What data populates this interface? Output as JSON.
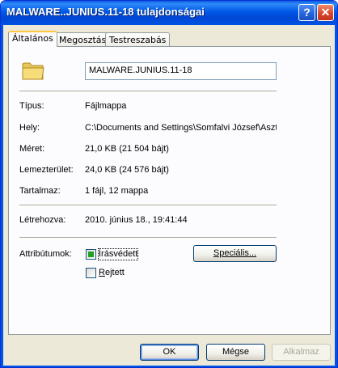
{
  "window": {
    "title": "MALWARE..JUNIUS.11-18 tulajdonságai",
    "help_label": "?",
    "close_label": "✕"
  },
  "tabs": [
    {
      "label": "Általános",
      "active": true
    },
    {
      "label": "Megosztás",
      "active": false
    },
    {
      "label": "Testreszabás",
      "active": false
    }
  ],
  "general": {
    "folder_icon": "folder-icon",
    "name": "MALWARE.JUNIUS.11-18",
    "type_label": "Típus:",
    "type_value": "Fájlmappa",
    "location_label": "Hely:",
    "location_value": "C:\\Documents and Settings\\Somfalvi József\\Asztal",
    "size_label": "Méret:",
    "size_value": "21,0 KB (21 504 bájt)",
    "disk_label": "Lemezterület:",
    "disk_value": "24,0 KB (24 576 bájt)",
    "contains_label": "Tartalmaz:",
    "contains_value": "1 fájl, 12 mappa",
    "created_label": "Létrehozva:",
    "created_value": "2010. június 18., 19:41:44",
    "attributes_label": "Attribútumok:",
    "readonly": {
      "label": "Írásvédett",
      "checked": true
    },
    "hidden": {
      "label_first": "R",
      "label_rest": "ejtett",
      "checked": false
    },
    "advanced_label": "Speciális..."
  },
  "footer": {
    "ok_label": "OK",
    "cancel_label": "Mégse",
    "apply_label": "Alkalmaz"
  },
  "colors": {
    "titlebar": "#0054e3",
    "dialog_bg": "#ece9d8",
    "checkbox_fill": "#21a121"
  }
}
